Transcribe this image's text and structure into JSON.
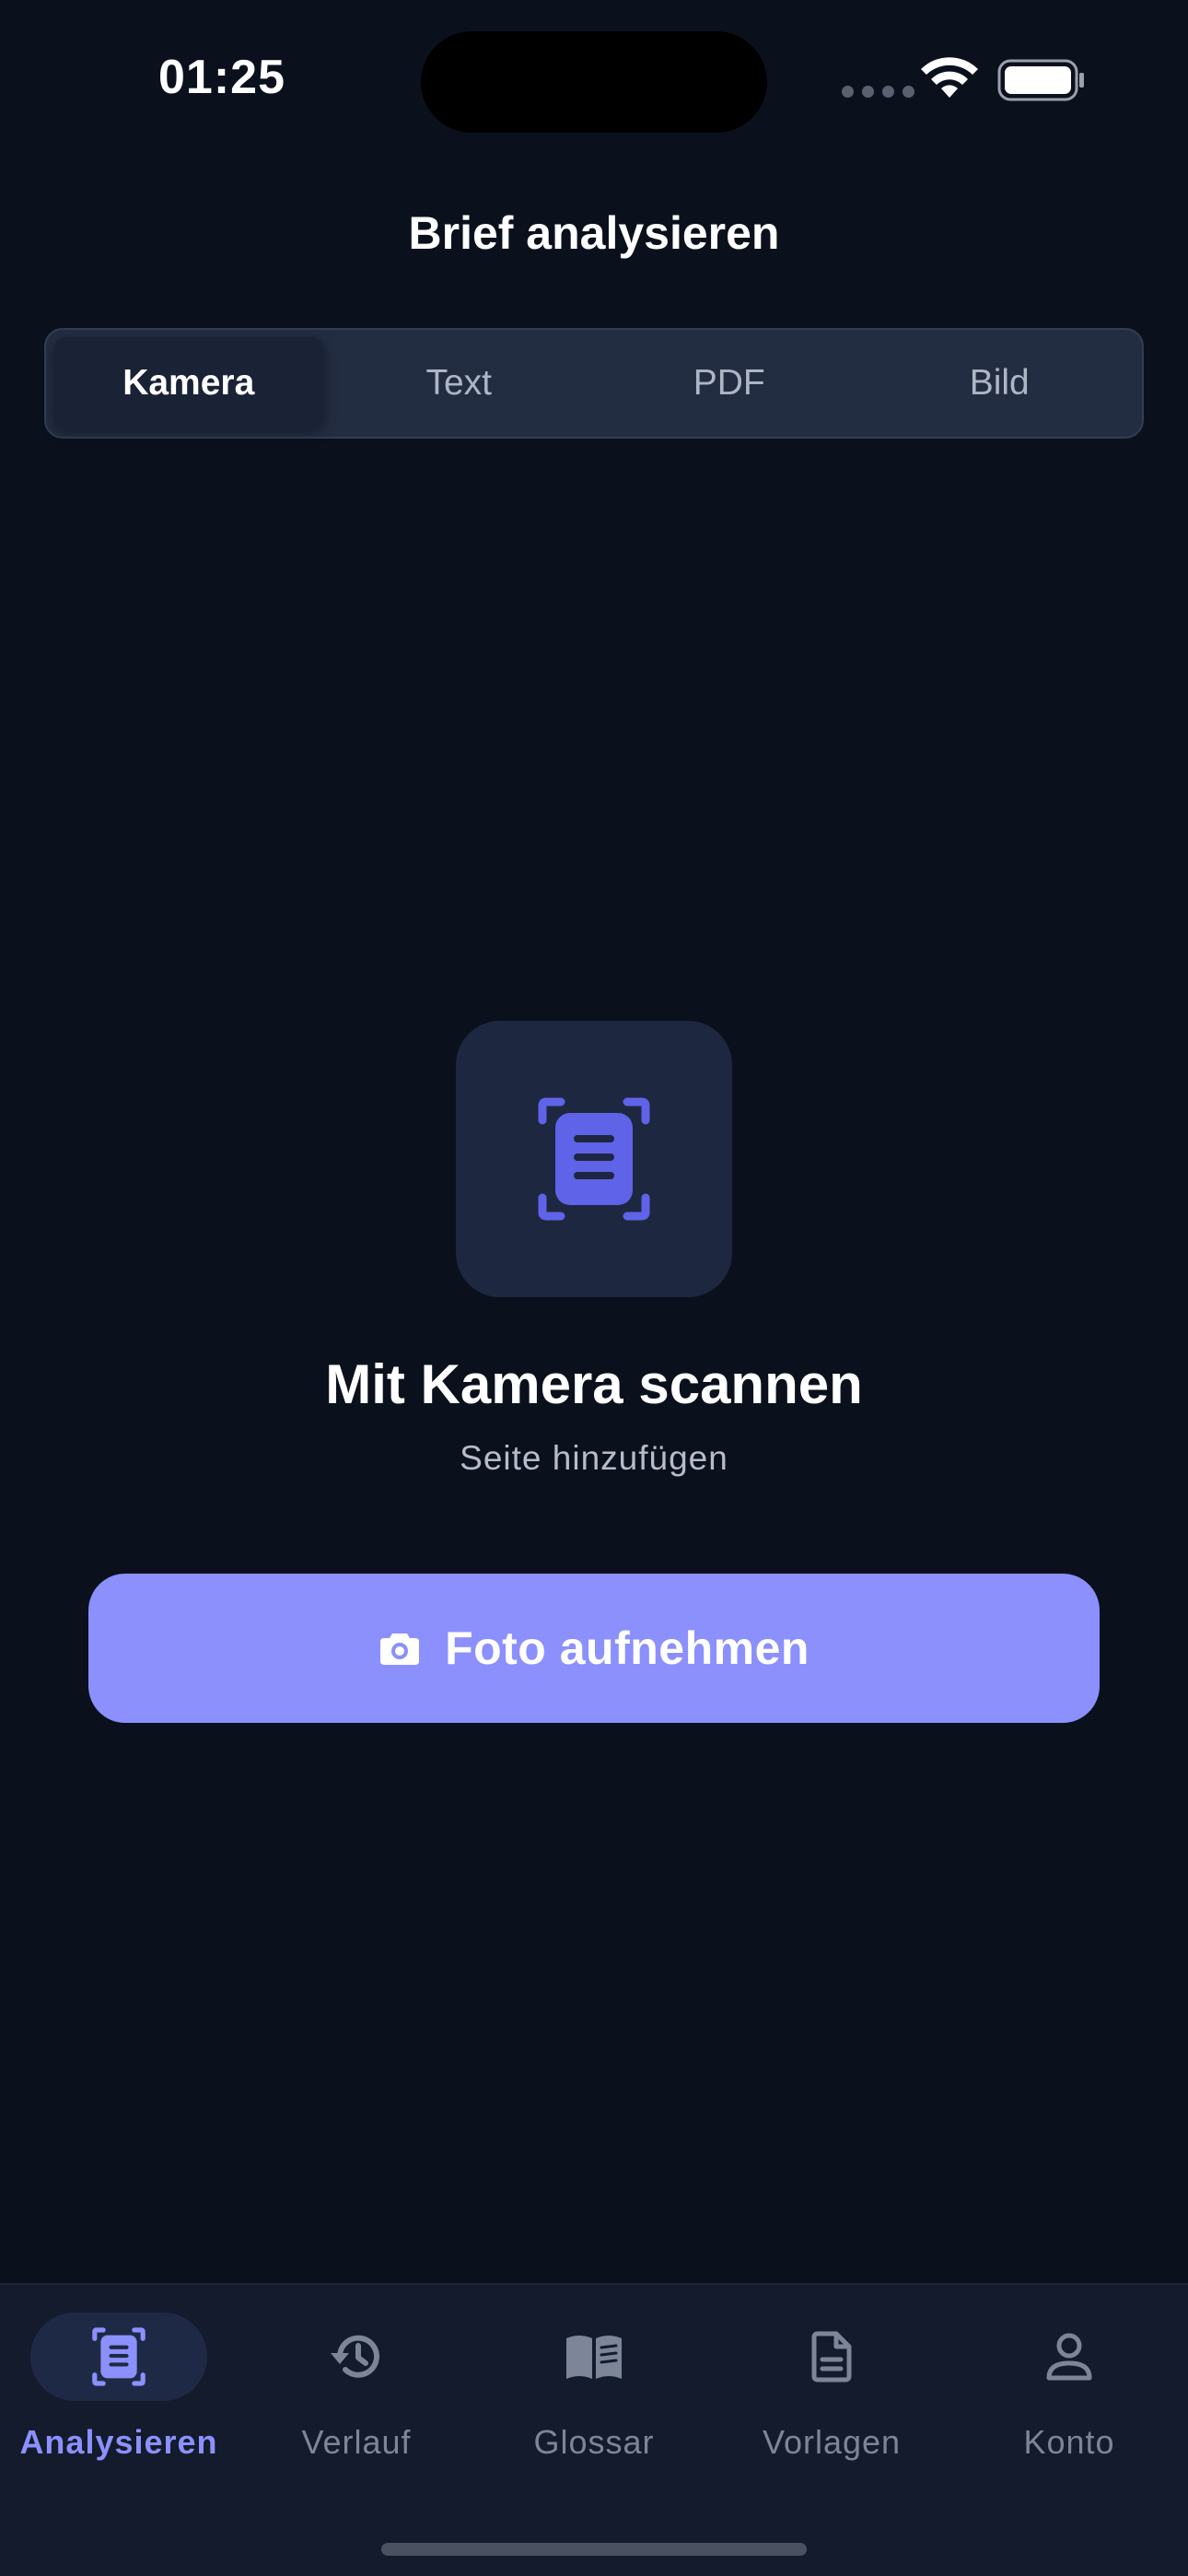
{
  "status_bar": {
    "time": "01:25"
  },
  "header": {
    "title": "Brief analysieren"
  },
  "segments": [
    {
      "label": "Kamera",
      "active": true
    },
    {
      "label": "Text",
      "active": false
    },
    {
      "label": "PDF",
      "active": false
    },
    {
      "label": "Bild",
      "active": false
    }
  ],
  "scan": {
    "icon": "document-scan-icon",
    "title": "Mit Kamera scannen",
    "subtitle": "Seite hinzufügen",
    "button_label": "Foto aufnehmen",
    "button_icon": "camera-icon"
  },
  "tabbar": {
    "items": [
      {
        "label": "Analysieren",
        "icon": "document-scan-icon",
        "active": true
      },
      {
        "label": "Verlauf",
        "icon": "history-icon",
        "active": false
      },
      {
        "label": "Glossar",
        "icon": "book-icon",
        "active": false
      },
      {
        "label": "Vorlagen",
        "icon": "document-icon",
        "active": false
      },
      {
        "label": "Konto",
        "icon": "person-icon",
        "active": false
      }
    ]
  },
  "colors": {
    "background": "#0b111c",
    "accent": "#8b90fc",
    "icon_accent": "#5f63e8",
    "inactive": "#7d8598"
  }
}
